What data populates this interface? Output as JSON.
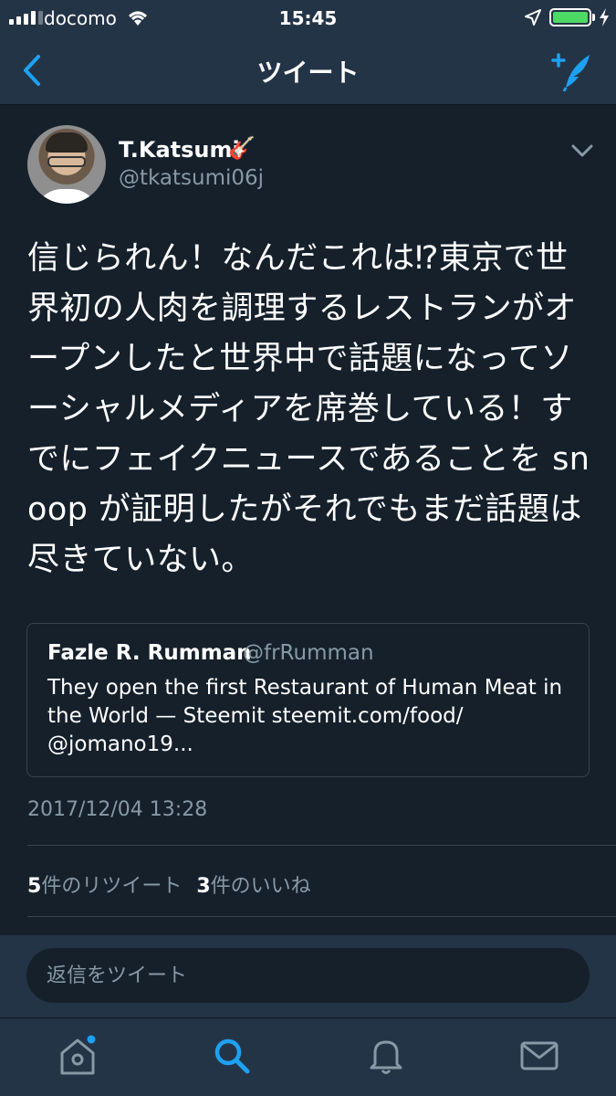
{
  "status_bar": {
    "carrier": "docomo",
    "time": "15:45",
    "battery_level": 1.0,
    "icons": [
      "signal-icon",
      "wifi-icon",
      "location-arrow-icon",
      "battery-icon",
      "charging-icon"
    ]
  },
  "nav": {
    "title": "ツイート",
    "back_icon": "chevron-left-icon",
    "compose_icon": "compose-tweet-icon"
  },
  "tweet": {
    "display_name": "T.Katsumi",
    "name_emoji": "🎸",
    "handle": "@tkatsumi06j",
    "text": "信じられん！なんだこれは⁉東京で世界初の人肉を調理するレストランがオープンしたと世界中で話題になってソーシャルメディアを席巻している！すでにフェイクニュースであることを snoop が証明したがそれでもまだ話題は尽きていない。",
    "quoted": {
      "name": "Fazle R. Rumman",
      "handle": "@frRumman",
      "text": "They open the first Restaurant of Human Meat in the World — Steemit steemit.com/food/ @jomano19..."
    },
    "timestamp": "2017/12/04 13:28",
    "stats": {
      "retweet_count": "5",
      "retweet_label": "件のリツイート",
      "like_count": "3",
      "like_label": "件のいいね"
    }
  },
  "reply": {
    "placeholder": "返信をツイート"
  },
  "tab_bar": {
    "active_tab": "search",
    "tabs": [
      "home-icon",
      "search-icon",
      "notifications-bell-icon",
      "messages-envelope-icon"
    ]
  },
  "colors": {
    "background": "#15202b",
    "bar": "#243447",
    "accent": "#1da1f2",
    "secondary_text": "#8899a6",
    "border": "#38444d"
  }
}
